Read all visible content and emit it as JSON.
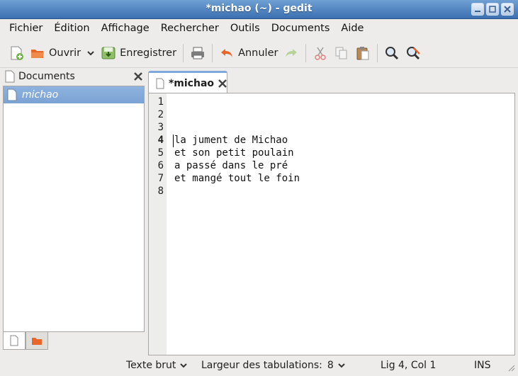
{
  "window": {
    "title": "*michao (~) - gedit"
  },
  "menu": [
    "Fichier",
    "Édition",
    "Affichage",
    "Rechercher",
    "Outils",
    "Documents",
    "Aide"
  ],
  "toolbar": {
    "open": "Ouvrir",
    "save": "Enregistrer",
    "undo": "Annuler"
  },
  "side_panel": {
    "title": "Documents",
    "documents": [
      "michao"
    ]
  },
  "tab": {
    "label": "*michao"
  },
  "editor": {
    "line_numbers": [
      "1",
      "2",
      "3",
      "4",
      "5",
      "6",
      "7",
      "8"
    ],
    "lines": [
      "",
      "",
      "",
      "la jument de Michao",
      "et son petit poulain",
      "a passé dans le pré",
      "et mangé tout le foin",
      ""
    ],
    "current_line": 4
  },
  "status": {
    "language": "Texte brut",
    "tab_width_label": "Largeur des tabulations:",
    "tab_width": "8",
    "position": "Lig 4, Col 1",
    "mode": "INS"
  },
  "colors": {
    "titlebar": "#4a7fc0",
    "selection": "#7aa2d3",
    "accent": "#e8662a"
  }
}
